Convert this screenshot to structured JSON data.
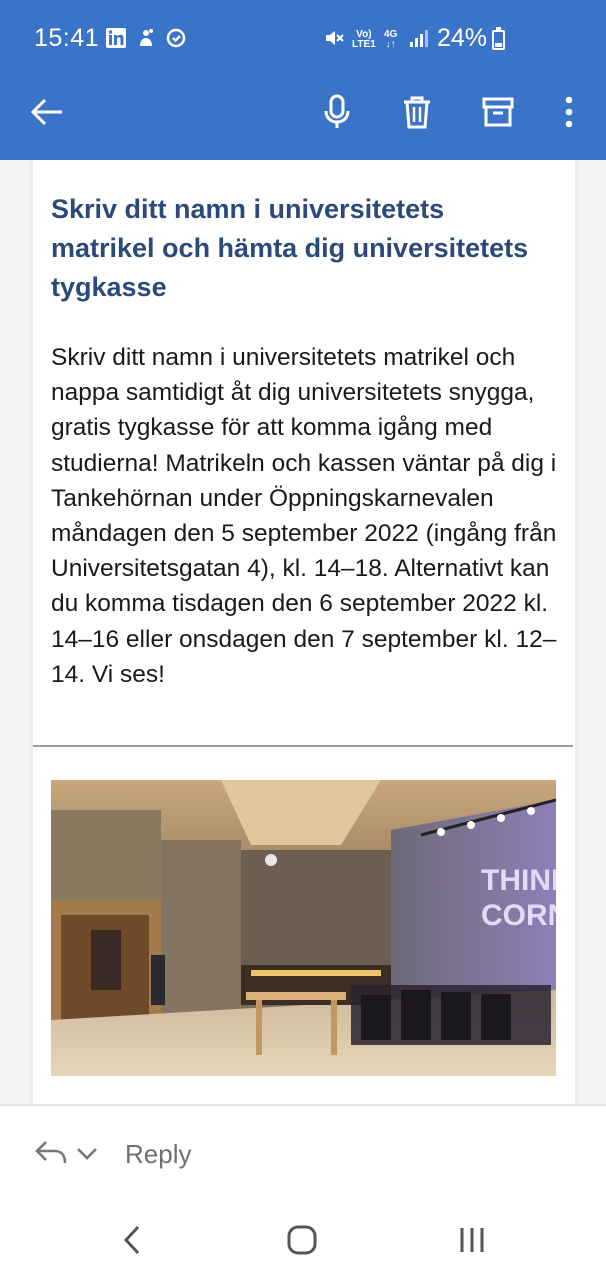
{
  "status_bar": {
    "time": "15:41",
    "network_top": "Vo)",
    "network_bottom": "LTE1",
    "net_type": "4G",
    "battery_percent": "24%",
    "battery_level": 0.24,
    "icons": [
      "linkedin-icon",
      "notification-icon",
      "sync-icon",
      "mute-icon",
      "signal-icon",
      "battery-icon"
    ]
  },
  "app_bar": {
    "icons": [
      "back-arrow-icon",
      "microphone-icon",
      "trash-icon",
      "archive-icon",
      "more-vert-icon"
    ]
  },
  "email": {
    "headline": "Skriv ditt namn i universitetets matrikel och hämta dig universitetets tygkasse",
    "body": "Skriv ditt namn i universitetets matrikel och nappa samtidigt åt dig universitetets snygga, gratis tygkasse för att komma igång med studierna! Matrikeln och kassen väntar på dig i Tankehörnan under Öppningskarnevalen måndagen den 5 september 2022 (ingång från Universitetsgatan 4), kl. 14–18. Alternativt kan du komma tisdagen den 6 september 2022 kl. 14–16 eller onsdagen den 7 september kl. 12–14. Vi ses!",
    "image_sign_text": "THINK CORNER"
  },
  "reply_bar": {
    "label": "Reply"
  },
  "colors": {
    "app_bar": "#3a74c9",
    "headline": "#2b4a7a",
    "body_text": "#1a1a1a"
  }
}
